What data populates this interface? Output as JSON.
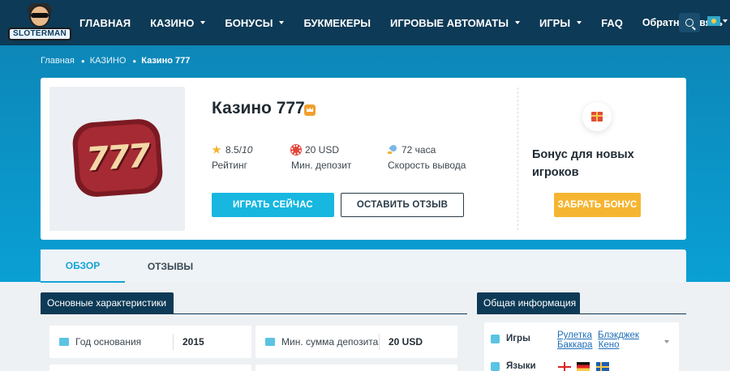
{
  "header": {
    "logo_text": "SLOTERMAN",
    "nav": [
      {
        "label": "ГЛАВНАЯ",
        "has_caret": false
      },
      {
        "label": "КАЗИНО",
        "has_caret": true
      },
      {
        "label": "БОНУСЫ",
        "has_caret": true
      },
      {
        "label": "БУКМЕКЕРЫ",
        "has_caret": false
      },
      {
        "label": "ИГРОВЫЕ АВТОМАТЫ",
        "has_caret": true
      },
      {
        "label": "ИГРЫ",
        "has_caret": true
      },
      {
        "label": "FAQ",
        "has_caret": false
      },
      {
        "label": "Обратная связь",
        "has_caret": false
      }
    ],
    "search_icon": "search-icon",
    "language_flag": "kazakhstan-flag-icon"
  },
  "breadcrumb": [
    "Главная",
    "КАЗИНО",
    "Казино 777"
  ],
  "casino": {
    "logo_text": "777",
    "title": "Казино 777",
    "stats": {
      "rating_value": "8.5/",
      "rating_max": "10",
      "rating_label": "Рейтинг",
      "deposit_value": "20 USD",
      "deposit_label": "Мин. депозит",
      "payout_value": "72 часа",
      "payout_label": "Скорость вывода"
    },
    "play_button": "ИГРАТЬ СЕЙЧАС",
    "review_button": "ОСТАВИТЬ ОТЗЫВ",
    "bonus_title": "Бонус для новых игроков",
    "bonus_button": "ЗАБРАТЬ БОНУС"
  },
  "tabs": [
    {
      "label": "ОБЗОР",
      "active": true
    },
    {
      "label": "ОТЗЫВЫ",
      "active": false
    }
  ],
  "characteristics": {
    "title": "Основные характеристики",
    "items": [
      {
        "key": "Год основания",
        "value": "2015"
      },
      {
        "key": "Мин. сумма депозита",
        "value": "20 USD"
      }
    ]
  },
  "general_info": {
    "title": "Общая информация",
    "games_label": "Игры",
    "games": [
      "Рулетка",
      "Блэкджек",
      "Баккара",
      "Кено"
    ],
    "languages_label": "Языки",
    "language_flags": [
      "england-flag-icon",
      "germany-flag-icon",
      "sweden-flag-icon"
    ]
  },
  "colors": {
    "header_bg": "#0d3a56",
    "hero_bg": "#0b95c8",
    "primary_button": "#17b7e0",
    "bonus_button": "#f6b531",
    "active_tab": "#14a3d8"
  }
}
